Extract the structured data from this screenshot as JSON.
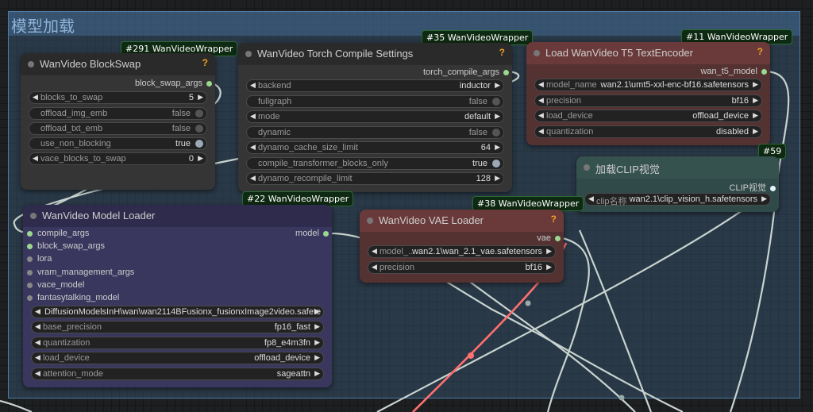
{
  "group": {
    "title": "模型加载"
  },
  "colors": {
    "wire_white": "#c8d3cf",
    "wire_red": "#ff7070",
    "port_green": "#9bd88f",
    "help": "#f0a020"
  },
  "blockswap": {
    "badge": "#291 WanVideoWrapper",
    "title": "WanVideo BlockSwap",
    "help": "?",
    "output": "block_swap_args",
    "widgets": [
      {
        "label": "blocks_to_swap",
        "value": "5"
      },
      {
        "label": "offload_img_emb",
        "value": "false"
      },
      {
        "label": "offload_txt_emb",
        "value": "false"
      },
      {
        "label": "use_non_blocking",
        "value": "true"
      },
      {
        "label": "vace_blocks_to_swap",
        "value": "0"
      }
    ]
  },
  "compile": {
    "badge": "#35 WanVideoWrapper",
    "title": "WanVideo Torch Compile Settings",
    "help": "?",
    "output": "torch_compile_args",
    "widgets": [
      {
        "label": "backend",
        "value": "inductor"
      },
      {
        "label": "fullgraph",
        "value": "false"
      },
      {
        "label": "mode",
        "value": "default"
      },
      {
        "label": "dynamic",
        "value": "false"
      },
      {
        "label": "dynamo_cache_size_limit",
        "value": "64"
      },
      {
        "label": "compile_transformer_blocks_only",
        "value": "true"
      },
      {
        "label": "dynamo_recompile_limit",
        "value": "128"
      }
    ]
  },
  "t5": {
    "badge": "#11 WanVideoWrapper",
    "title": "Load WanVideo T5 TextEncoder",
    "help": "?",
    "output": "wan_t5_model",
    "widgets": [
      {
        "label": "model_name",
        "value": "wan2.1\\umt5-xxl-enc-bf16.safetensors"
      },
      {
        "label": "precision",
        "value": "bf16"
      },
      {
        "label": "load_device",
        "value": "offload_device"
      },
      {
        "label": "quantization",
        "value": "disabled"
      }
    ]
  },
  "clip": {
    "badge": "#59",
    "title": "加载CLIP视觉",
    "output": "CLIP视觉",
    "widgets": [
      {
        "label": "clip名称",
        "value": "wan2.1\\clip_vision_h.safetensors"
      }
    ]
  },
  "loader": {
    "badge": "#22 WanVideoWrapper",
    "title": "WanVideo Model Loader",
    "output": "model",
    "inputs": [
      "compile_args",
      "block_swap_args",
      "lora",
      "vram_management_args",
      "vace_model",
      "fantasytalking_model"
    ],
    "widgets": [
      {
        "label": "",
        "value": "DiffusionModelsInH\\wan\\wan2114BFusionx_fusionxImage2video.safete"
      },
      {
        "label": "base_precision",
        "value": "fp16_fast"
      },
      {
        "label": "quantization",
        "value": "fp8_e4m3fn"
      },
      {
        "label": "load_device",
        "value": "offload_device"
      },
      {
        "label": "attention_mode",
        "value": "sageattn"
      }
    ]
  },
  "vae": {
    "badge": "#38 WanVideoWrapper",
    "title": "WanVideo VAE Loader",
    "help": "?",
    "output": "vae",
    "widgets": [
      {
        "label": "model_...",
        "value": "wan2.1\\wan_2.1_vae.safetensors"
      },
      {
        "label": "precision",
        "value": "bf16"
      }
    ]
  }
}
